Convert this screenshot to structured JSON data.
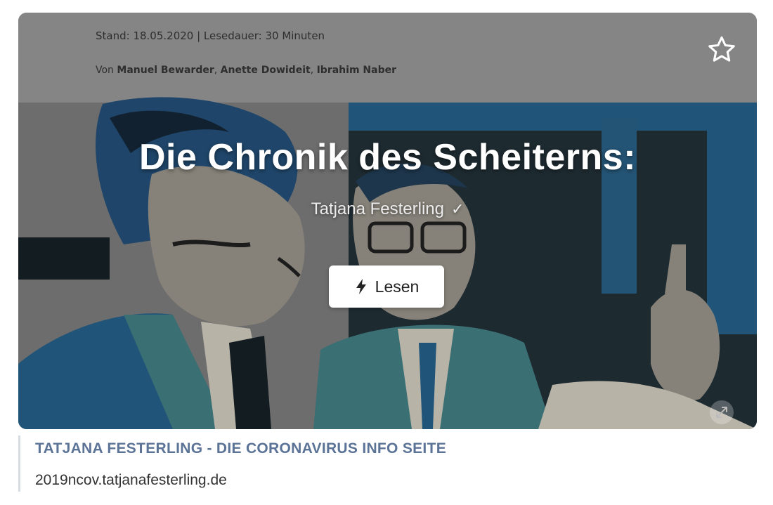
{
  "card": {
    "meta": "Stand: 18.05.2020 | Lesedauer: 30 Minuten",
    "byline_prefix": "Von",
    "authors": [
      "Manuel Bewarder",
      "Anette Dowideit",
      "Ibrahim Naber"
    ],
    "title": "Die Chronik des Scheiterns:",
    "poster": "Tatjana Festerling",
    "verified_icon": "check-icon",
    "read_button": {
      "label": "Lesen",
      "icon": "lightning-icon"
    },
    "favorite_icon": "star-outline-icon",
    "expand_icon": "expand-icon"
  },
  "link_preview": {
    "title": "TATJANA FESTERLING - DIE CORONAVIRUS INFO SEITE",
    "url": "2019ncov.tatjanafesterling.de"
  },
  "colors": {
    "link_title": "#5b7396",
    "art_blue": "#1f5f8b",
    "art_teal": "#3f7f86"
  }
}
